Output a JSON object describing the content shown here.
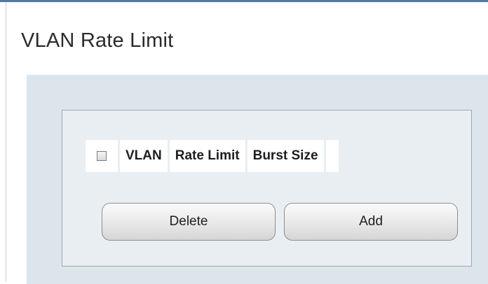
{
  "page": {
    "title": "VLAN Rate Limit"
  },
  "table": {
    "select_all_label": "",
    "columns": [
      "VLAN",
      "Rate Limit",
      "Burst Size"
    ]
  },
  "buttons": {
    "delete_label": "Delete",
    "add_label": "Add"
  }
}
